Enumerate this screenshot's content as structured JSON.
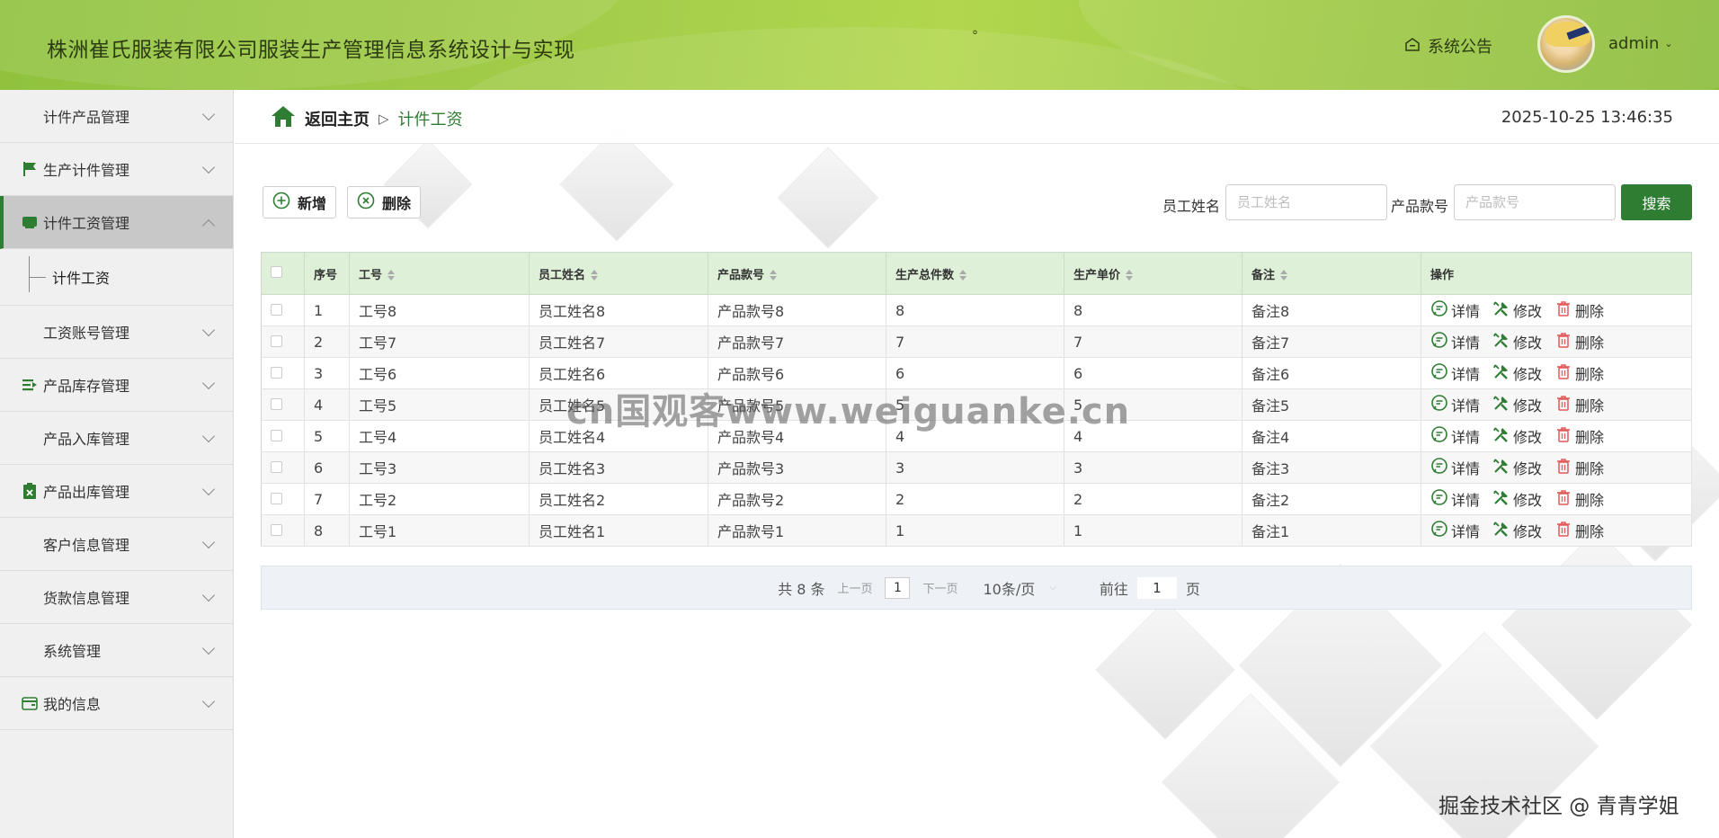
{
  "header": {
    "app_title": "株洲崔氏服装有限公司服装生产管理信息系统设计与实现",
    "dot": "°",
    "notice_label": "系统公告",
    "username": "admin",
    "user_caret": "⌄",
    "accent_color": "#a4cd4a"
  },
  "sidebar": {
    "items": [
      {
        "label": "计件产品管理",
        "icon": "grid-icon"
      },
      {
        "label": "生产计件管理",
        "icon": "flag-icon"
      },
      {
        "label": "计件工资管理",
        "icon": "card-icon",
        "active": true
      },
      {
        "label": "工资账号管理",
        "icon": "grid-icon"
      },
      {
        "label": "产品库存管理",
        "icon": "list-arrow-icon"
      },
      {
        "label": "产品入库管理",
        "icon": "grid9-icon"
      },
      {
        "label": "产品出库管理",
        "icon": "clipboard-icon"
      },
      {
        "label": "客户信息管理",
        "icon": "grid-icon"
      },
      {
        "label": "货款信息管理",
        "icon": "grid-icon"
      },
      {
        "label": "系统管理",
        "icon": "grid-icon"
      },
      {
        "label": "我的信息",
        "icon": "wallet-icon"
      }
    ],
    "submenu": "计件工资"
  },
  "breadcrumb": {
    "home": "返回主页",
    "separator": "▷",
    "current": "计件工资"
  },
  "datetime": "2025-10-25 13:46:35",
  "toolbar": {
    "add_label": "新增",
    "delete_label": "删除"
  },
  "search": {
    "name_label": "员工姓名",
    "name_placeholder": "员工姓名",
    "product_label": "产品款号",
    "product_placeholder": "产品款号",
    "button_label": "搜索"
  },
  "table": {
    "columns": [
      "序号",
      "工号",
      "员工姓名",
      "产品款号",
      "生产总件数",
      "生产单价",
      "备注",
      "操作"
    ],
    "rows": [
      [
        "1",
        "工号8",
        "员工姓名8",
        "产品款号8",
        "8",
        "8",
        "备注8"
      ],
      [
        "2",
        "工号7",
        "员工姓名7",
        "产品款号7",
        "7",
        "7",
        "备注7"
      ],
      [
        "3",
        "工号6",
        "员工姓名6",
        "产品款号6",
        "6",
        "6",
        "备注6"
      ],
      [
        "4",
        "工号5",
        "员工姓名5",
        "产品款号5",
        "5",
        "5",
        "备注5"
      ],
      [
        "5",
        "工号4",
        "员工姓名4",
        "产品款号4",
        "4",
        "4",
        "备注4"
      ],
      [
        "6",
        "工号3",
        "员工姓名3",
        "产品款号3",
        "3",
        "3",
        "备注3"
      ],
      [
        "7",
        "工号2",
        "员工姓名2",
        "产品款号2",
        "2",
        "2",
        "备注2"
      ],
      [
        "8",
        "工号1",
        "员工姓名1",
        "产品款号1",
        "1",
        "1",
        "备注1"
      ]
    ],
    "actions": {
      "detail": "详情",
      "edit": "修改",
      "delete": "删除"
    }
  },
  "pagination": {
    "total": "共 8 条",
    "prev": "上一页",
    "page": "1",
    "next": "下一页",
    "page_size": "10条/页",
    "goto_label": "前往",
    "goto_value": "1",
    "goto_suffix": "页"
  },
  "watermark": "cn国观客www.weiguanke.cn",
  "credit": "掘金技术社区 @ 青青学姐"
}
